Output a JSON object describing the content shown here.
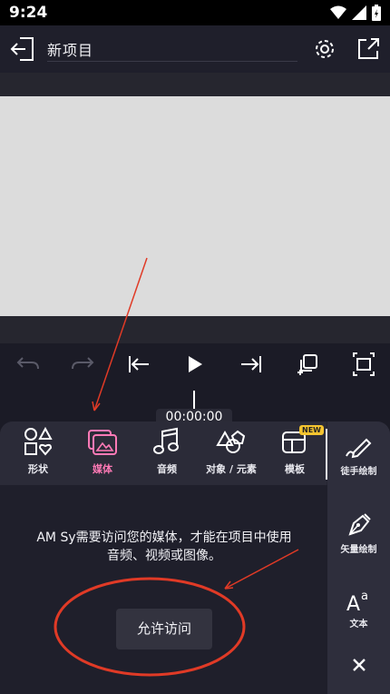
{
  "status": {
    "time": "9:24"
  },
  "header": {
    "project_title": "新项目"
  },
  "timeline": {
    "timecode": "00:00:00"
  },
  "tabs": [
    {
      "label": "形状"
    },
    {
      "label": "媒体"
    },
    {
      "label": "音频"
    },
    {
      "label": "对象 / 元素"
    },
    {
      "label": "模板",
      "badge": "NEW"
    }
  ],
  "sidebar": {
    "freehand": "徒手绘制",
    "vector": "矢量绘制",
    "text": "文本"
  },
  "media_panel": {
    "message_line1": "AM Sy需要访问您的媒体，才能在项目中使用",
    "message_line2": "音频、视频或图像。",
    "allow_button": "允许访问"
  },
  "colors": {
    "accent_pink": "#ff7ab6",
    "annotation_red": "#e03a26",
    "badge_yellow": "#f4c430"
  }
}
